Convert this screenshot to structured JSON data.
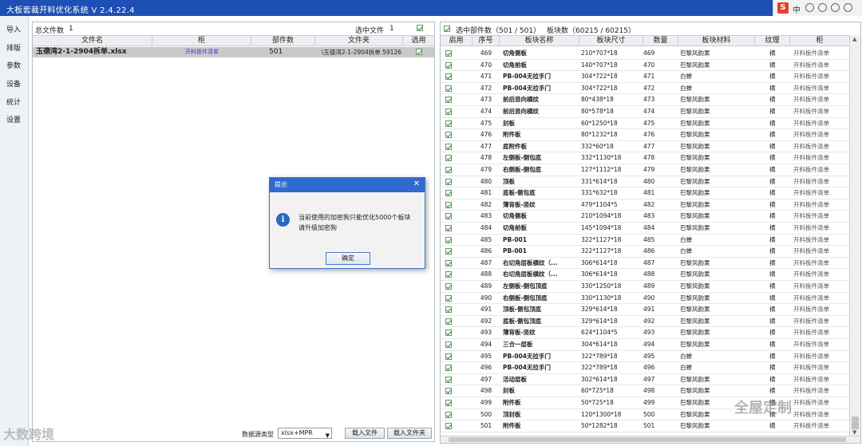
{
  "app": {
    "title": "大板套裁开料优化系统 V 2.4.22.4"
  },
  "ime": {
    "logo": "S",
    "lang": "中"
  },
  "sidebar": {
    "items": [
      "导入",
      "排版",
      "参数",
      "设备",
      "统计",
      "设置"
    ]
  },
  "files": {
    "total_label": "总文件数",
    "total_value": "1",
    "selected_label": "选中文件",
    "selected_value": "1",
    "columns": [
      "文件名",
      "柜",
      "部件数",
      "文件夹",
      "选用"
    ],
    "rows": [
      {
        "name": "玉德湾2-1-2904拆单.xlsx",
        "cabinet": "开料板件清单",
        "count": "501",
        "folder": "\\玉德湾2-1-2904拆单 59126"
      }
    ],
    "source_label": "数据源类型",
    "source_value": "xlsx+MPR",
    "load_file_button": "载入文件",
    "load_folder_button": "载入文件夹"
  },
  "parts": {
    "selected_label": "选中部件数（501 / 501）",
    "boards_label": "板块数（60215 / 60215）",
    "columns": [
      "启用",
      "序号",
      "板块名称",
      "板块尺寸",
      "数量",
      "板块材料",
      "纹理",
      "柜"
    ],
    "rows": [
      {
        "no": "469",
        "name": "切角侧板",
        "size": "210*707*18",
        "qty": "469",
        "mat": "巴黎风韵果",
        "grain": "横",
        "cab": "开料板件清单"
      },
      {
        "no": "470",
        "name": "切角前板",
        "size": "140*707*18",
        "qty": "470",
        "mat": "巴黎风韵果",
        "grain": "横",
        "cab": "开料板件清单"
      },
      {
        "no": "471",
        "name": "PB-004无拉手门",
        "size": "304*722*18",
        "qty": "471",
        "mat": "白蝉",
        "grain": "横",
        "cab": "开料板件清单"
      },
      {
        "no": "472",
        "name": "PB-004无拉手门",
        "size": "304*722*18",
        "qty": "472",
        "mat": "白蝉",
        "grain": "横",
        "cab": "开料板件清单"
      },
      {
        "no": "473",
        "name": "前后竖向横纹",
        "size": "80*438*18",
        "qty": "473",
        "mat": "巴黎风韵果",
        "grain": "横",
        "cab": "开料板件清单"
      },
      {
        "no": "474",
        "name": "前后竖向横纹",
        "size": "80*578*18",
        "qty": "474",
        "mat": "巴黎风韵果",
        "grain": "横",
        "cab": "开料板件清单"
      },
      {
        "no": "475",
        "name": "封板",
        "size": "60*1250*18",
        "qty": "475",
        "mat": "巴黎风韵果",
        "grain": "横",
        "cab": "开料板件清单"
      },
      {
        "no": "476",
        "name": "附件板",
        "size": "80*1232*18",
        "qty": "476",
        "mat": "巴黎风韵果",
        "grain": "横",
        "cab": "开料板件清单"
      },
      {
        "no": "477",
        "name": "底附件板",
        "size": "332*60*18",
        "qty": "477",
        "mat": "巴黎风韵果",
        "grain": "横",
        "cab": "开料板件清单"
      },
      {
        "no": "478",
        "name": "左侧板-侧包底",
        "size": "332*1130*18",
        "qty": "478",
        "mat": "巴黎风韵果",
        "grain": "横",
        "cab": "开料板件清单"
      },
      {
        "no": "479",
        "name": "右侧板-侧包底",
        "size": "127*1112*18",
        "qty": "479",
        "mat": "巴黎风韵果",
        "grain": "横",
        "cab": "开料板件清单"
      },
      {
        "no": "480",
        "name": "顶板",
        "size": "331*614*18",
        "qty": "480",
        "mat": "巴黎风韵果",
        "grain": "横",
        "cab": "开料板件清单"
      },
      {
        "no": "481",
        "name": "底板-侧包底",
        "size": "331*632*18",
        "qty": "481",
        "mat": "巴黎风韵果",
        "grain": "横",
        "cab": "开料板件清单"
      },
      {
        "no": "482",
        "name": "薄背板-竖纹",
        "size": "479*1104*5",
        "qty": "482",
        "mat": "巴黎风韵果",
        "grain": "横",
        "cab": "开料板件清单"
      },
      {
        "no": "483",
        "name": "切角侧板",
        "size": "210*1094*18",
        "qty": "483",
        "mat": "巴黎风韵果",
        "grain": "横",
        "cab": "开料板件清单"
      },
      {
        "no": "484",
        "name": "切角前板",
        "size": "145*1094*18",
        "qty": "484",
        "mat": "巴黎风韵果",
        "grain": "横",
        "cab": "开料板件清单"
      },
      {
        "no": "485",
        "name": "PB-001",
        "size": "322*1127*18",
        "qty": "485",
        "mat": "白蝉",
        "grain": "横",
        "cab": "开料板件清单"
      },
      {
        "no": "486",
        "name": "PB-001",
        "size": "322*1127*18",
        "qty": "486",
        "mat": "白蝉",
        "grain": "横",
        "cab": "开料板件清单"
      },
      {
        "no": "487",
        "name": "右切角层板横纹（...",
        "size": "306*614*18",
        "qty": "487",
        "mat": "巴黎风韵果",
        "grain": "横",
        "cab": "开料板件清单"
      },
      {
        "no": "488",
        "name": "右切角层板横纹（...",
        "size": "306*614*18",
        "qty": "488",
        "mat": "巴黎风韵果",
        "grain": "横",
        "cab": "开料板件清单"
      },
      {
        "no": "489",
        "name": "左侧板-侧包顶底",
        "size": "330*1250*18",
        "qty": "489",
        "mat": "巴黎风韵果",
        "grain": "横",
        "cab": "开料板件清单"
      },
      {
        "no": "490",
        "name": "右侧板-侧包顶底",
        "size": "330*1130*18",
        "qty": "490",
        "mat": "巴黎风韵果",
        "grain": "横",
        "cab": "开料板件清单"
      },
      {
        "no": "491",
        "name": "顶板-侧包顶底",
        "size": "329*614*18",
        "qty": "491",
        "mat": "巴黎风韵果",
        "grain": "横",
        "cab": "开料板件清单"
      },
      {
        "no": "492",
        "name": "底板-侧包顶底",
        "size": "329*614*18",
        "qty": "492",
        "mat": "巴黎风韵果",
        "grain": "横",
        "cab": "开料板件清单"
      },
      {
        "no": "493",
        "name": "薄背板-竖纹",
        "size": "624*1104*5",
        "qty": "493",
        "mat": "巴黎风韵果",
        "grain": "横",
        "cab": "开料板件清单"
      },
      {
        "no": "494",
        "name": "三合一层板",
        "size": "304*614*18",
        "qty": "494",
        "mat": "巴黎风韵果",
        "grain": "横",
        "cab": "开料板件清单"
      },
      {
        "no": "495",
        "name": "PB-004无拉手门",
        "size": "322*789*18",
        "qty": "495",
        "mat": "白蝉",
        "grain": "横",
        "cab": "开料板件清单"
      },
      {
        "no": "496",
        "name": "PB-004无拉手门",
        "size": "322*789*18",
        "qty": "496",
        "mat": "白蝉",
        "grain": "横",
        "cab": "开料板件清单"
      },
      {
        "no": "497",
        "name": "活动层板",
        "size": "302*614*18",
        "qty": "497",
        "mat": "巴黎风韵果",
        "grain": "横",
        "cab": "开料板件清单"
      },
      {
        "no": "498",
        "name": "封板",
        "size": "60*725*18",
        "qty": "498",
        "mat": "巴黎风韵果",
        "grain": "横",
        "cab": "开料板件清单"
      },
      {
        "no": "499",
        "name": "附件板",
        "size": "50*725*18",
        "qty": "499",
        "mat": "巴黎风韵果",
        "grain": "横",
        "cab": "开料板件清单"
      },
      {
        "no": "500",
        "name": "顶封板",
        "size": "120*1300*18",
        "qty": "500",
        "mat": "巴黎风韵果",
        "grain": "横",
        "cab": "开料板件清单"
      },
      {
        "no": "501",
        "name": "附件板",
        "size": "50*1282*18",
        "qty": "501",
        "mat": "巴黎风韵果",
        "grain": "横",
        "cab": "开料板件清单"
      }
    ]
  },
  "dialog": {
    "title": "提示",
    "icon": "info-icon",
    "message_line1": "当前使用的加密狗只能优化5000个板块",
    "message_line2": "请升级加密狗",
    "ok_button": "确定"
  },
  "watermarks": {
    "left": "大数跨境",
    "right": "全屋定制"
  },
  "colors": {
    "titlebar": "#1e4fb4",
    "dialog_title": "#2f6ad0",
    "selected_row": "#c9c9c9"
  }
}
